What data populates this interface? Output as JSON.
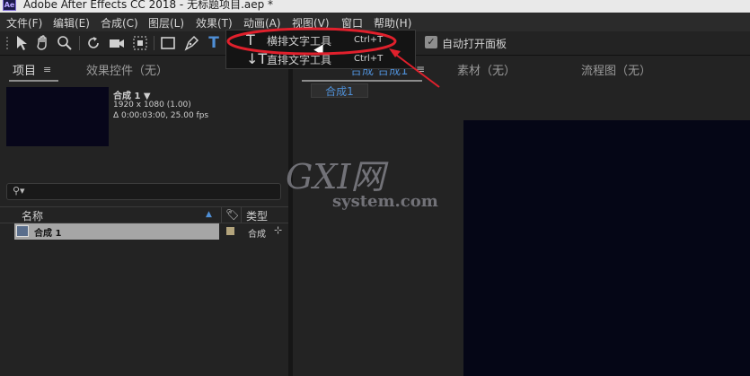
{
  "titlebar": {
    "logo": "Ae",
    "title": "Adobe After Effects CC 2018 - 无标题项目.aep *"
  },
  "menu": [
    "文件(F)",
    "编辑(E)",
    "合成(C)",
    "图层(L)",
    "效果(T)",
    "动画(A)",
    "视图(V)",
    "窗口",
    "帮助(H)"
  ],
  "toolbar": {
    "tools": [
      "selection-icon",
      "hand-icon",
      "zoom-icon",
      "rotate-icon",
      "camera-icon",
      "pan-behind-icon",
      "rectangle-icon",
      "pen-icon",
      "type-icon"
    ],
    "auto_open_label": "自动打开面板",
    "auto_open_checked": true
  },
  "dropdown": {
    "items": [
      {
        "label": "横排文字工具",
        "shortcut": "Ctrl+T",
        "icon": "type-horizontal-icon"
      },
      {
        "label": "直排文字工具",
        "shortcut": "Ctrl+T",
        "icon": "type-vertical-icon"
      }
    ]
  },
  "project_panel": {
    "tab_project": "项目",
    "tab_effects": "效果控件（无）",
    "comp_name": "合成 1 ▼",
    "comp_size": "1920 x 1080 (1.00)",
    "comp_duration": "Δ 0:00:03:00, 25.00 fps",
    "columns": {
      "name": "名称",
      "type": "类型"
    },
    "rows": [
      {
        "name": "合成 1",
        "type": "合成"
      }
    ]
  },
  "right_panel": {
    "tab_comp": "合成 合成1",
    "tab_footage": "素材（无）",
    "tab_flowchart": "流程图（无）",
    "comp_chip": "合成1"
  },
  "watermark": {
    "line1": "GXI网",
    "line2": "system.com"
  },
  "colors": {
    "accent_blue": "#4f8fd6",
    "highlight_red": "#e0202c",
    "comp_bg": "#050616"
  }
}
